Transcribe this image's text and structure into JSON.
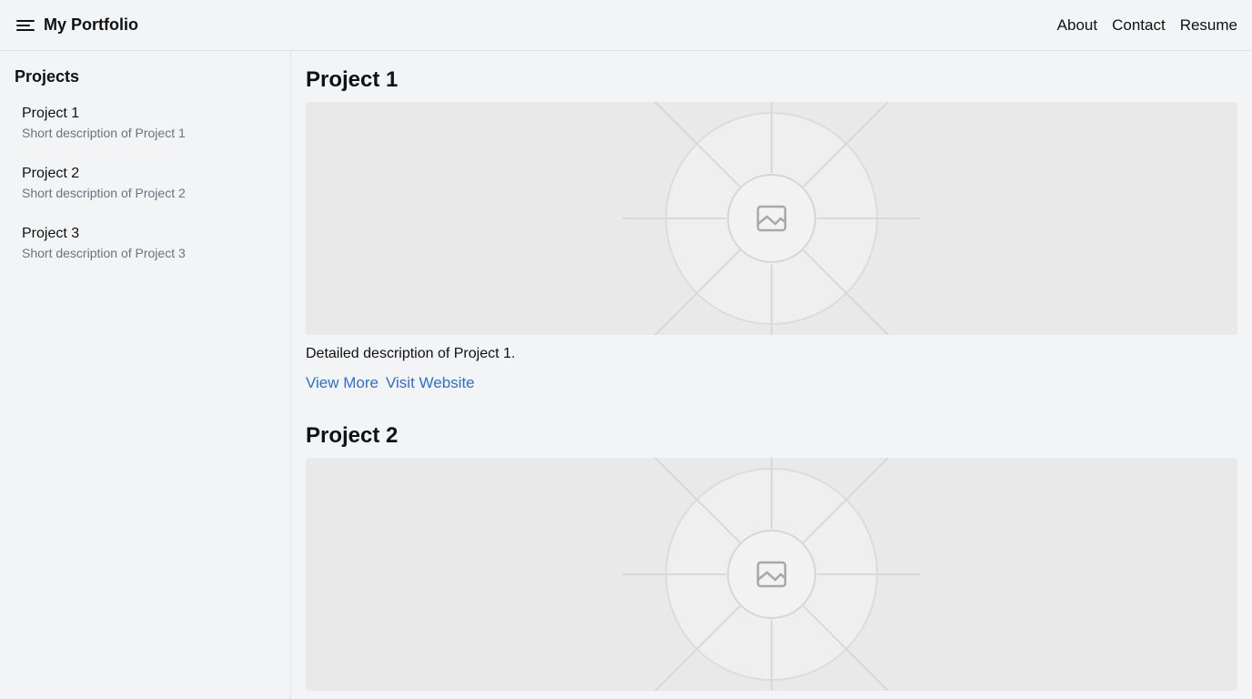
{
  "header": {
    "title": "My Portfolio",
    "menu_icon": "hamburger-menu-icon",
    "nav": [
      "About",
      "Contact",
      "Resume"
    ]
  },
  "sidebar": {
    "title": "Projects",
    "items": [
      {
        "name": "Project 1",
        "description": "Short description of Project 1"
      },
      {
        "name": "Project 2",
        "description": "Short description of Project 2"
      },
      {
        "name": "Project 3",
        "description": "Short description of Project 3"
      }
    ]
  },
  "main": {
    "projects": [
      {
        "title": "Project 1",
        "image_icon": "image-placeholder-icon",
        "detail": "Detailed description of Project 1.",
        "links": [
          "View More",
          "Visit Website"
        ]
      },
      {
        "title": "Project 2",
        "image_icon": "image-placeholder-icon"
      }
    ]
  },
  "colors": {
    "background": "#f3f4f6",
    "link": "#2f6fce",
    "muted_text": "#6b7280",
    "placeholder": "#e9e9e9"
  }
}
